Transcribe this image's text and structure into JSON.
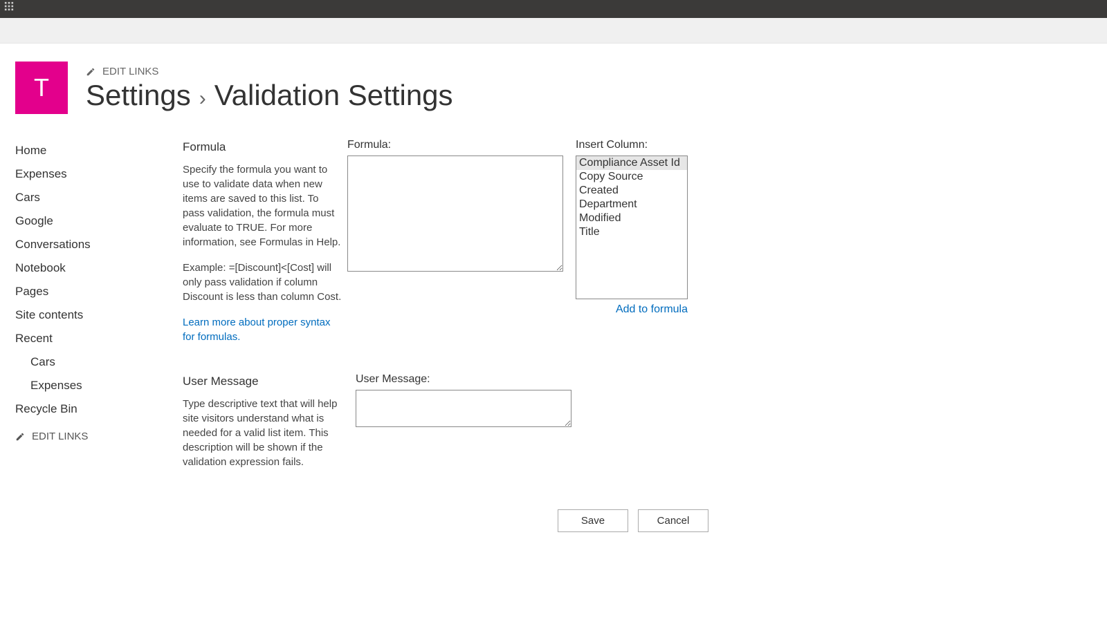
{
  "siteLogoLetter": "T",
  "header": {
    "editLinks": "EDIT LINKS",
    "breadcrumbParent": "Settings",
    "breadcrumbSep": "›",
    "breadcrumbCurrent": "Validation Settings"
  },
  "nav": {
    "items": [
      "Home",
      "Expenses",
      "Cars",
      "Google",
      "Conversations",
      "Notebook",
      "Pages",
      "Site contents",
      "Recent"
    ],
    "recent": [
      "Cars",
      "Expenses"
    ],
    "recycle": "Recycle Bin",
    "editLinks": "EDIT LINKS"
  },
  "formulaSection": {
    "heading": "Formula",
    "desc1": "Specify the formula you want to use to validate data when new items are saved to this list. To pass validation, the formula must evaluate to TRUE. For more information, see Formulas in Help.",
    "desc2": "Example: =[Discount]<[Cost] will only pass validation if column Discount is less than column Cost.",
    "learnMore": "Learn more about proper syntax for formulas.",
    "fieldLabel": "Formula:",
    "insertLabel": "Insert Column:",
    "columns": [
      "Compliance Asset Id",
      "Copy Source",
      "Created",
      "Department",
      "Modified",
      "Title"
    ],
    "addToFormula": "Add to formula",
    "formulaValue": ""
  },
  "userMsgSection": {
    "heading": "User Message",
    "desc": "Type descriptive text that will help site visitors understand what is needed for a valid list item. This description will be shown if the validation expression fails.",
    "fieldLabel": "User Message:",
    "value": ""
  },
  "buttons": {
    "save": "Save",
    "cancel": "Cancel"
  }
}
